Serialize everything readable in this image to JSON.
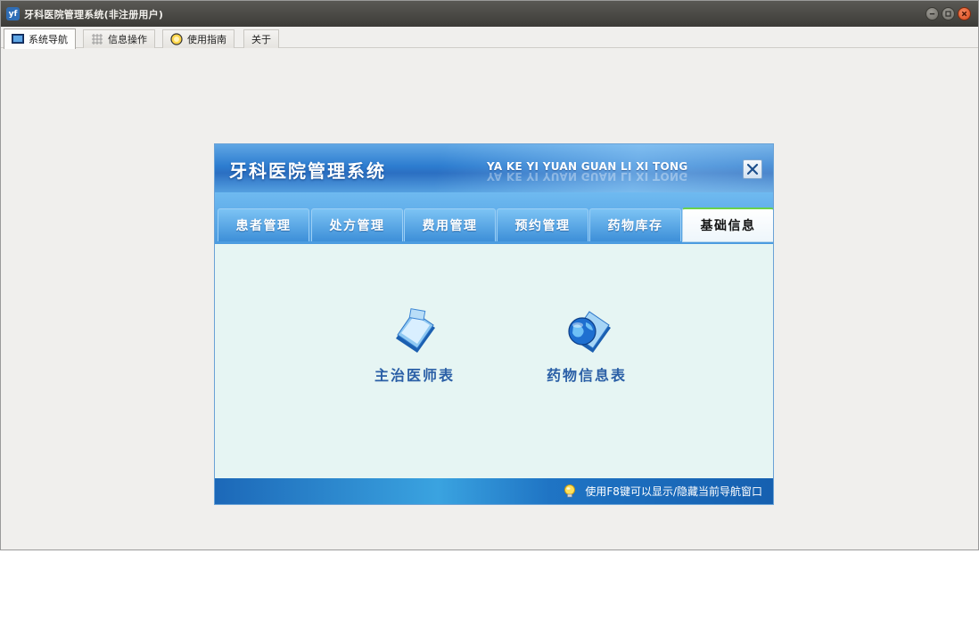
{
  "window": {
    "title": "牙科医院管理系统(非注册用户)",
    "app_icon_text": "yf"
  },
  "top_tabs": [
    {
      "label": "系统导航",
      "icon": "monitor-icon",
      "active": true
    },
    {
      "label": "信息操作",
      "icon": "grid-icon",
      "active": false
    },
    {
      "label": "使用指南",
      "icon": "help-icon",
      "active": false
    },
    {
      "label": "关于",
      "icon": "",
      "active": false
    }
  ],
  "nav_panel": {
    "title": "牙科医院管理系统",
    "pinyin": "YA KE YI YUAN GUAN LI XI TONG",
    "tabs": [
      {
        "label": "患者管理",
        "active": false
      },
      {
        "label": "处方管理",
        "active": false
      },
      {
        "label": "费用管理",
        "active": false
      },
      {
        "label": "预约管理",
        "active": false
      },
      {
        "label": "药物库存",
        "active": false
      },
      {
        "label": "基础信息",
        "active": true
      }
    ],
    "items": [
      {
        "label": "主治医师表",
        "icon": "document-icon"
      },
      {
        "label": "药物信息表",
        "icon": "globe-document-icon"
      }
    ],
    "footer_hint": "使用F8键可以显示/隐藏当前导航窗口"
  },
  "colors": {
    "titlebar": "#3c3b37",
    "nav_header": "#2d7dd0",
    "nav_body": "#e6f5f3",
    "label_blue": "#2a5fa6",
    "active_tab_accent": "#6ad24a"
  }
}
